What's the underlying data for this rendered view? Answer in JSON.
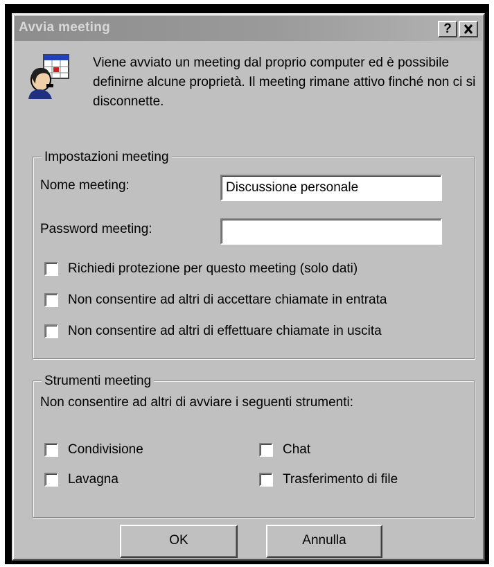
{
  "window": {
    "title": "Avvia meeting",
    "help_button": "?",
    "close_button": "×"
  },
  "intro": {
    "icon": "meeting-person-icon",
    "text": "Viene avviato un meeting dal proprio computer ed è possibile definirne alcune proprietà. Il meeting rimane attivo finché non ci si disconnette."
  },
  "settings_group": {
    "label": "Impostazioni meeting",
    "name_label": "Nome meeting:",
    "name_value": "Discussione personale",
    "password_label": "Password meeting:",
    "password_value": "",
    "checkboxes": [
      {
        "label": "Richiedi protezione per questo meeting (solo dati)",
        "checked": false
      },
      {
        "label": "Non consentire ad altri di accettare chiamate in entrata",
        "checked": false
      },
      {
        "label": "Non consentire ad altri di effettuare chiamate in uscita",
        "checked": false
      }
    ]
  },
  "tools_group": {
    "label": "Strumenti meeting",
    "description": "Non consentire ad altri di avviare i seguenti strumenti:",
    "tools": [
      {
        "label": "Condivisione",
        "checked": false
      },
      {
        "label": "Chat",
        "checked": false
      },
      {
        "label": "Lavagna",
        "checked": false
      },
      {
        "label": "Trasferimento di file",
        "checked": false
      }
    ]
  },
  "buttons": {
    "ok": "OK",
    "cancel": "Annulla"
  },
  "colors": {
    "face": "#c0c0c0",
    "titlebar": "#9a9a9a",
    "frame": "#000000"
  }
}
